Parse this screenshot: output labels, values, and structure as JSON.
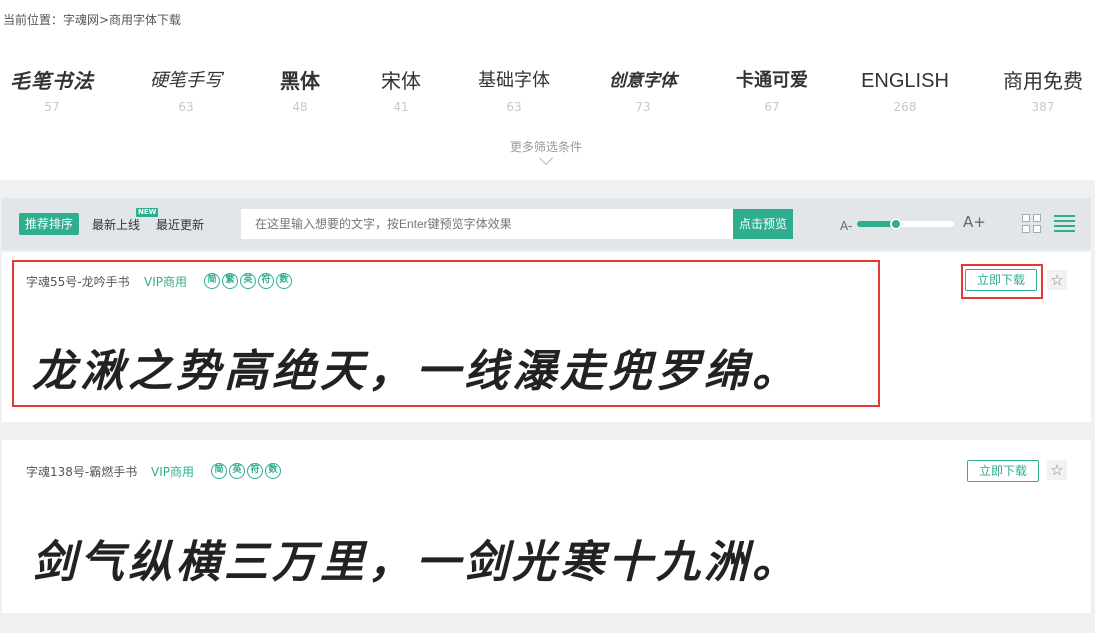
{
  "breadcrumb": "当前位置：字魂网>商用字体下载",
  "categories": [
    {
      "name": "毛笔书法",
      "count": "57"
    },
    {
      "name": "硬笔手写",
      "count": "63"
    },
    {
      "name": "黑体",
      "count": "48"
    },
    {
      "name": "宋体",
      "count": "41"
    },
    {
      "name": "基础字体",
      "count": "63"
    },
    {
      "name": "创意字体",
      "count": "73"
    },
    {
      "name": "卡通可爱",
      "count": "67"
    },
    {
      "name": "ENGLISH",
      "count": "268"
    },
    {
      "name": "商用免费",
      "count": "387"
    }
  ],
  "more_filters": "更多筛选条件",
  "toolbar": {
    "sort_recommended": "推荐排序",
    "sort_newest": "最新上线",
    "new_badge": "NEW",
    "sort_updated": "最近更新",
    "preview_placeholder": "在这里输入想要的文字，按Enter键预览字体效果",
    "preview_button": "点击预览",
    "size_small": "A-",
    "size_large": "A+",
    "size_level": 0.4
  },
  "fonts": [
    {
      "name": "字魂55号-龙吟手书",
      "license": "VIP商用",
      "badges": [
        "简",
        "繁",
        "英",
        "符",
        "数"
      ],
      "download": "立即下载",
      "sample": "龙湫之势高绝天，一线瀑走兜罗绵。"
    },
    {
      "name": "字魂138号-霸燃手书",
      "license": "VIP商用",
      "badges": [
        "简",
        "英",
        "符",
        "数"
      ],
      "download": "立即下载",
      "sample": "剑气纵横三万里，一剑光寒十九洲。"
    }
  ],
  "colors": {
    "accent": "#2fae8f",
    "highlight": "#e53935"
  }
}
